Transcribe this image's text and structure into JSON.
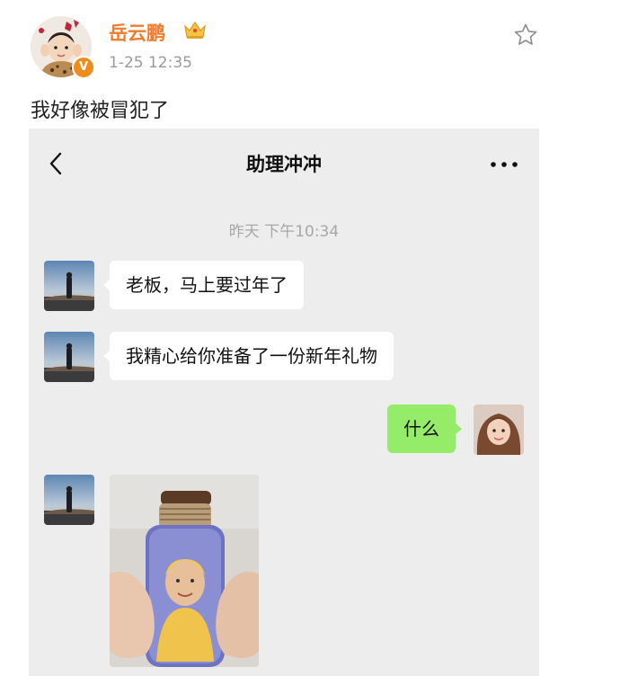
{
  "post": {
    "username": "岳云鹏",
    "time": "1-25 12:35",
    "text": "我好像被冒犯了",
    "verified_mark": "V",
    "icons": {
      "crown": "crown-icon",
      "favorite": "star-icon"
    },
    "colors": {
      "username": "#f27a2a",
      "verified": "#f08c1c"
    }
  },
  "chat": {
    "title": "助理冲冲",
    "timestamp": "昨天 下午10:34",
    "icons": {
      "back": "chevron-left-icon",
      "more": "more-dots-icon"
    },
    "messages": [
      {
        "from": "other",
        "text": "老板，马上要过年了"
      },
      {
        "from": "other",
        "text": "我精心给你准备了一份新年礼物"
      },
      {
        "from": "me",
        "text": "什么"
      },
      {
        "from": "other",
        "type": "image",
        "text": ""
      }
    ],
    "colors": {
      "background": "#ededed",
      "bubble_other": "#ffffff",
      "bubble_me": "#95ec69"
    }
  }
}
